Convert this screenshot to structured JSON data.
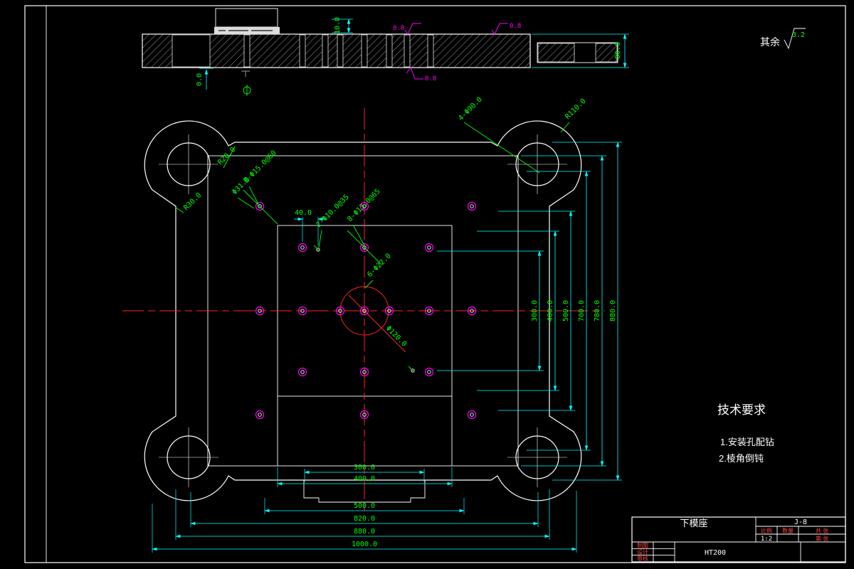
{
  "surface_note": {
    "prefix": "其余",
    "value": "3.2"
  },
  "section": {
    "dim_step": "10.0",
    "dim_height": "80.0",
    "dim_datum": "0.0",
    "finish_top_1": "0.8",
    "finish_top_2": "0.8",
    "finish_bottom": "0.8"
  },
  "plan": {
    "callouts": {
      "corner_holes": "4-Φ90.0",
      "corner_radius": "R110.0",
      "fillet_top": "R20.0",
      "fillet_side": "R30.0",
      "guide_hole": "Φ31.0",
      "ring_holes": "8-Φ15.0@60",
      "pitch": "40.0",
      "dowel_holes": "2-Φ10.0@35",
      "bolt_holes": "8-Φ13.0@65",
      "center_holes": "6-Φ22.0",
      "center_circle": "Φ120.0"
    },
    "dims_right": [
      "300.0",
      "400.0",
      "500.0",
      "700.0",
      "780.0",
      "880.0"
    ],
    "dims_bottom": [
      "300.0",
      "400.0",
      "500.0",
      "820.0",
      "880.0",
      "1000.0"
    ]
  },
  "tech_req": {
    "title": "技术要求",
    "item1": "1.安装孔配钻",
    "item2": "2.棱角倒钝"
  },
  "title_block": {
    "part_name": "下模座",
    "drawing_no": "J-8",
    "scale_label": "比例",
    "scale_value": "1:2",
    "qty_label": "数量",
    "sheet_total": "共 张",
    "sheet_no": "第 张",
    "material": "HT200",
    "sig_row1": "制图",
    "sig_row2": "设计",
    "sig_row3": "审核"
  },
  "colors": {
    "background": "#000000",
    "outline": "#ffffff",
    "dimension_line": "#00ffff",
    "dimension_text": "#00ff00",
    "centerline": "#ff2222",
    "hole": "#ff00ff"
  }
}
